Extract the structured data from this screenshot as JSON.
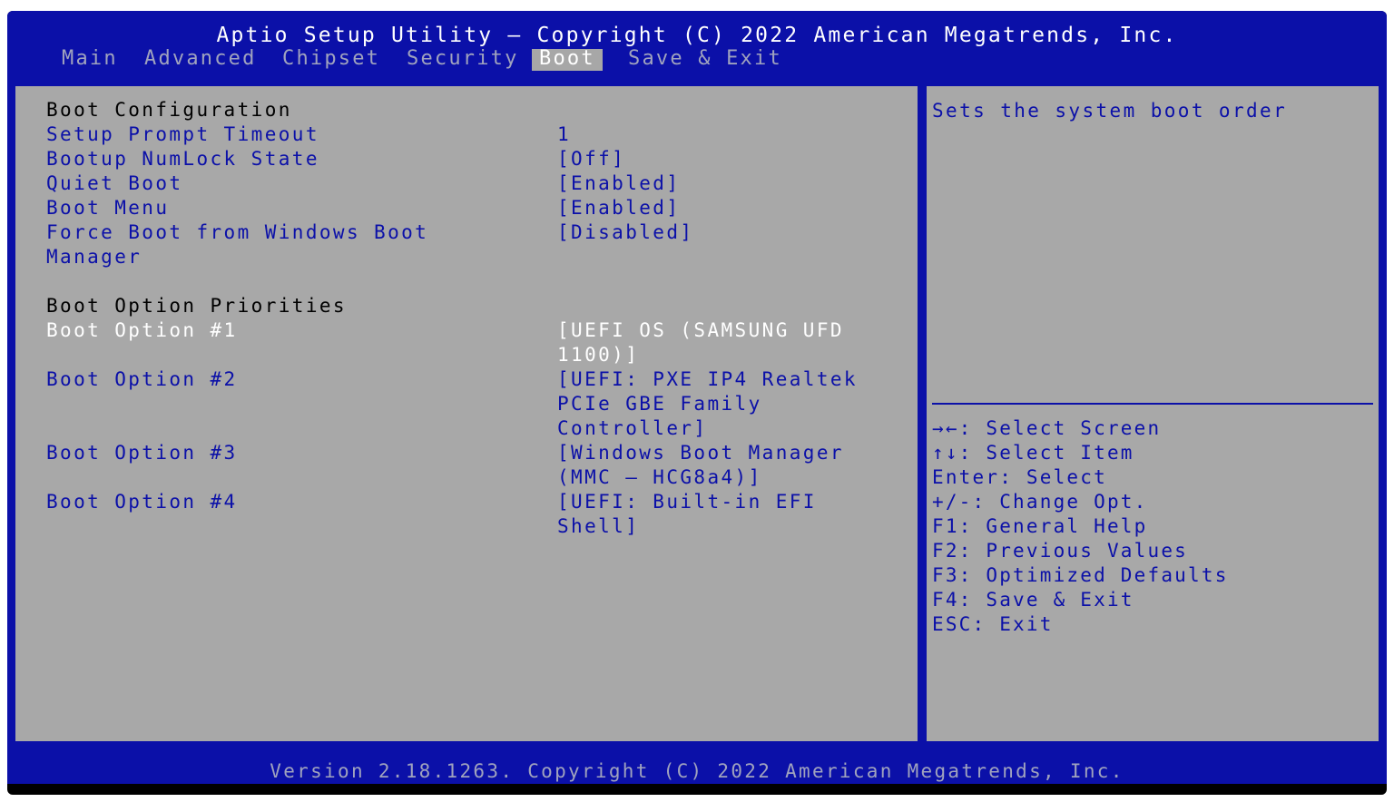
{
  "header": {
    "title": "Aptio Setup Utility – Copyright (C) 2022 American Megatrends, Inc.",
    "tabs": [
      "Main",
      "Advanced",
      "Chipset",
      "Security",
      "Boot",
      "Save & Exit"
    ],
    "active_tab": "Boot"
  },
  "settings": {
    "section_boot_configuration": "Boot Configuration",
    "setup_prompt_timeout": {
      "label": "Setup Prompt Timeout",
      "value": "1"
    },
    "bootup_numlock_state": {
      "label": "Bootup NumLock State",
      "value": "[Off]"
    },
    "quiet_boot": {
      "label": "Quiet Boot",
      "value": "[Enabled]"
    },
    "boot_menu": {
      "label": "Boot Menu",
      "value": "[Enabled]"
    },
    "force_boot": {
      "label_line1": "Force Boot from Windows Boot",
      "label_line2": "Manager",
      "value": "[Disabled]"
    },
    "section_boot_option_priorities": "Boot Option Priorities",
    "boot_option_1": {
      "label": "Boot Option #1",
      "value_line1": "[UEFI OS (SAMSUNG UFD",
      "value_line2": "1100)]"
    },
    "boot_option_2": {
      "label": "Boot Option #2",
      "value_line1": "[UEFI: PXE IP4 Realtek",
      "value_line2": "PCIe GBE Family",
      "value_line3": "Controller]"
    },
    "boot_option_3": {
      "label": "Boot Option #3",
      "value_line1": "[Windows Boot Manager",
      "value_line2": "(MMC – HCG8a4)]"
    },
    "boot_option_4": {
      "label": "Boot Option #4",
      "value_line1": "[UEFI: Built-in EFI",
      "value_line2": "Shell]"
    }
  },
  "help": {
    "description": "Sets the system boot order",
    "keys": [
      "→←: Select Screen",
      "↑↓: Select Item",
      "Enter: Select",
      "+/-: Change Opt.",
      "F1: General Help",
      "F2: Previous Values",
      "F3: Optimized Defaults",
      "F4: Save & Exit",
      "ESC: Exit"
    ]
  },
  "footer": {
    "version": "Version 2.18.1263. Copyright (C) 2022 American Megatrends, Inc."
  },
  "colors": {
    "bios_blue": "#0b10a8",
    "pane_gray": "#a8a8a8",
    "highlight_white": "#ffffff",
    "inactive_tab_gray": "#a0a3be"
  }
}
